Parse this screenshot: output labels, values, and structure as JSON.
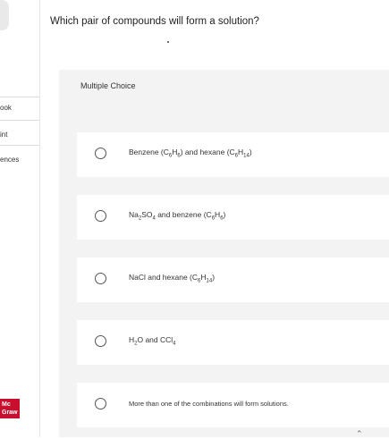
{
  "sidebar": {
    "items": [
      {
        "label": "ook"
      },
      {
        "label": "int"
      },
      {
        "label": "ences"
      }
    ],
    "brand_text": "Mc\nGraw"
  },
  "question": {
    "text": "Which pair of compounds will form a solution?"
  },
  "multiple_choice": {
    "label": "Multiple Choice",
    "options": [
      {
        "parts": [
          "Benzene (C",
          "6",
          "H",
          "6",
          ") and hexane (C",
          "6",
          "H",
          "14",
          ")"
        ]
      },
      {
        "parts": [
          "Na",
          "2",
          "SO",
          "4",
          " and benzene (C",
          "6",
          "H",
          "6",
          ")"
        ]
      },
      {
        "parts": [
          "NaCl and hexane (C",
          "6",
          "H",
          "14",
          ")"
        ]
      },
      {
        "parts": [
          "H",
          "2",
          "O and CCl",
          "4"
        ]
      },
      {
        "parts": [
          "More than one of the combinations will form solutions."
        ]
      }
    ]
  }
}
